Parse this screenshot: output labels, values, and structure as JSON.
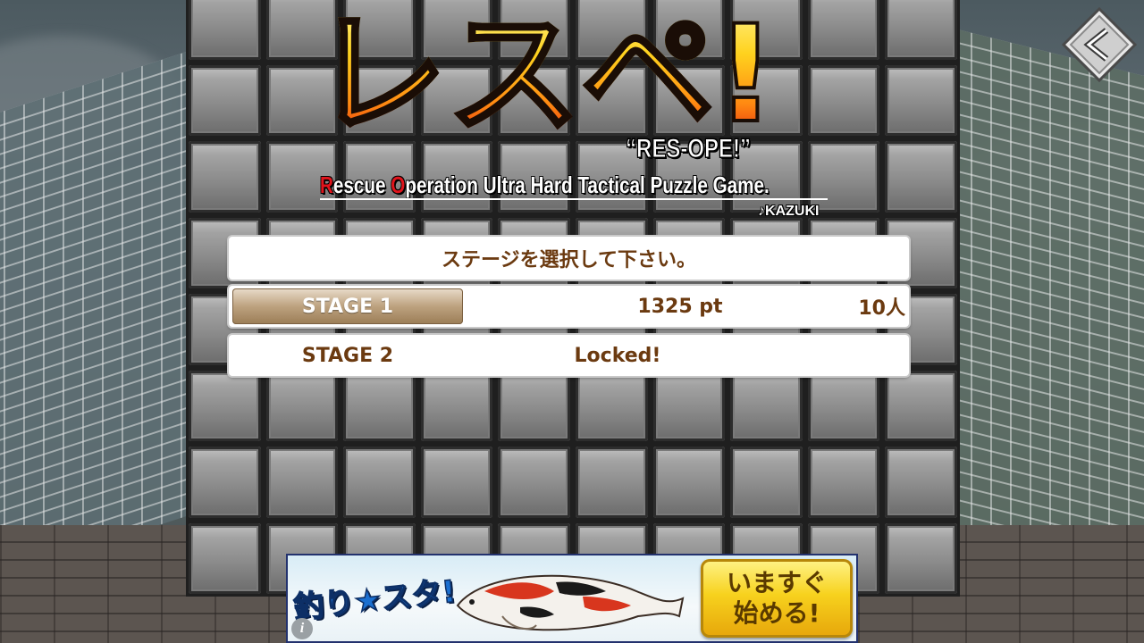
{
  "logo": {
    "chars": [
      "レ",
      "ス",
      "ペ",
      "!"
    ],
    "subtitle": "“RES-OPE!”",
    "tagline": {
      "r_letter": "R",
      "r_rest": "escue ",
      "o_letter": "O",
      "o_rest": "peration Ultra Hard Tactical Puzzle Game."
    },
    "credit": "♪KAZUKI"
  },
  "menu": {
    "header": "ステージを選択して下さい。",
    "stages": [
      {
        "label": "STAGE 1",
        "score": "1325 pt",
        "people": "10人",
        "selected": true
      },
      {
        "label": "STAGE 2",
        "score": "Locked!",
        "people": "",
        "selected": false
      }
    ]
  },
  "back_button": {
    "icon": "back-arrow-icon"
  },
  "ad": {
    "logo_text": "釣り★スタ!",
    "cta": "いますぐ\n始める!",
    "info_icon": "info-icon",
    "info_glyph": "i"
  },
  "colors": {
    "panel_text": "#6b3a10",
    "accent_red": "#e0141c",
    "selected_stage": "#bda27f"
  }
}
